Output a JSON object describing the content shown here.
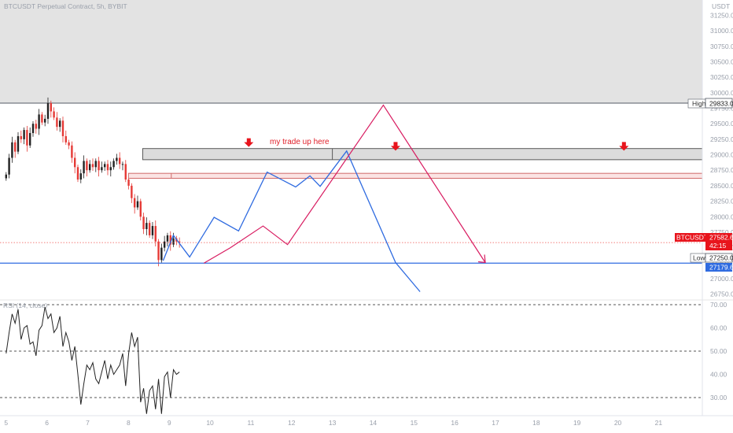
{
  "header": {
    "symbol_line": "BTCUSDT Perpetual Contract, 5h, BYBIT",
    "currency": "USDT"
  },
  "annotations": {
    "trade_note": "my trade up here"
  },
  "colors": {
    "candle_up": "#222222",
    "candle_down": "#e53935",
    "projection_blue": "#2f6be0",
    "projection_pink": "#d81b60",
    "zone_fill": "#e3e3e3",
    "resistance_fill": "#fbe4e4",
    "arrow_red": "#e8141c"
  },
  "price_tags": {
    "high": {
      "label": "High",
      "value": "29833.0"
    },
    "current": {
      "label": "BTCUSDT.P",
      "value": "27582.6",
      "countdown": "42:15"
    },
    "low": {
      "label": "Low",
      "value": "27250.0"
    },
    "blue_line": {
      "value": "27179.6"
    }
  },
  "rsi": {
    "label": "RSI (14, close)",
    "levels": [
      70,
      50,
      30
    ]
  },
  "chart_data": {
    "type": "candlestick",
    "title": "BTCUSDT Perpetual Contract, 5h, BYBIT",
    "x_tick_labels": [
      "5",
      "6",
      "7",
      "8",
      "9",
      "10",
      "11",
      "12",
      "13",
      "14",
      "15",
      "16",
      "17",
      "18",
      "19",
      "20",
      "21"
    ],
    "x_range_days": [
      5,
      21.8
    ],
    "y_tick_labels": [
      "31250.0",
      "31000.0",
      "30750.0",
      "30500.0",
      "30250.0",
      "30000.0",
      "29750.0",
      "29500.0",
      "29250.0",
      "29000.0",
      "28750.0",
      "28500.0",
      "28250.0",
      "28000.0",
      "27750.0",
      "27500.0",
      "27250.0",
      "27000.0",
      "26750.0"
    ],
    "ylim": [
      26600,
      31400
    ],
    "candles_close": [
      28680,
      28950,
      29200,
      29050,
      29300,
      29250,
      29400,
      29150,
      29350,
      29500,
      29420,
      29650,
      29520,
      29580,
      29833,
      29700,
      29600,
      29450,
      29550,
      29300,
      29200,
      29150,
      28950,
      28800,
      28600,
      28700,
      28900,
      28750,
      28850,
      28800,
      28900,
      28750,
      28800,
      28850,
      28750,
      28800,
      28900,
      28950,
      28850,
      28850,
      28600,
      28500,
      28300,
      28150,
      28250,
      28000,
      27800,
      27900,
      27700,
      27850,
      27600,
      27300,
      27500,
      27600,
      27700,
      27550,
      27650,
      27600,
      27580
    ],
    "candles_start_day": 5.0,
    "candles_end_day": 9.25,
    "supply_zone": {
      "from": 28920,
      "to": 29100,
      "from_day": 8.35
    },
    "resistance_band": {
      "from": 28620,
      "to": 28700,
      "from_day": 8.0
    },
    "high_line": 29833,
    "low_line": 27250,
    "current_price": 27582.6,
    "arrows": [
      {
        "x": 10.95,
        "y": 29190
      },
      {
        "x": 14.55,
        "y": 29130
      },
      {
        "x": 20.15,
        "y": 29130
      }
    ],
    "blue_projection": [
      [
        8.85,
        27290
      ],
      [
        9.1,
        27700
      ],
      [
        9.5,
        27350
      ],
      [
        10.1,
        27990
      ],
      [
        10.7,
        27770
      ],
      [
        11.4,
        28720
      ],
      [
        12.1,
        28480
      ],
      [
        12.45,
        28660
      ],
      [
        12.7,
        28490
      ],
      [
        13.35,
        29060
      ],
      [
        14.55,
        27260
      ],
      [
        15.15,
        26790
      ]
    ],
    "pink_projection": [
      [
        9.85,
        27250
      ],
      [
        10.5,
        27500
      ],
      [
        11.3,
        27850
      ],
      [
        11.9,
        27550
      ],
      [
        14.25,
        29800
      ],
      [
        16.75,
        27260
      ]
    ],
    "rsi_values": [
      49,
      58,
      66,
      62,
      68,
      55,
      60,
      61,
      53,
      54,
      48,
      59,
      61,
      69,
      64,
      66,
      58,
      60,
      65,
      52,
      58,
      54,
      46,
      52,
      40,
      27,
      36,
      44,
      42,
      45,
      38,
      36,
      41,
      46,
      38,
      44,
      40,
      42,
      44,
      49,
      35,
      49,
      58,
      52,
      56,
      28,
      34,
      23,
      33,
      35,
      25,
      38,
      23,
      39,
      41,
      30,
      42,
      40,
      41
    ]
  }
}
